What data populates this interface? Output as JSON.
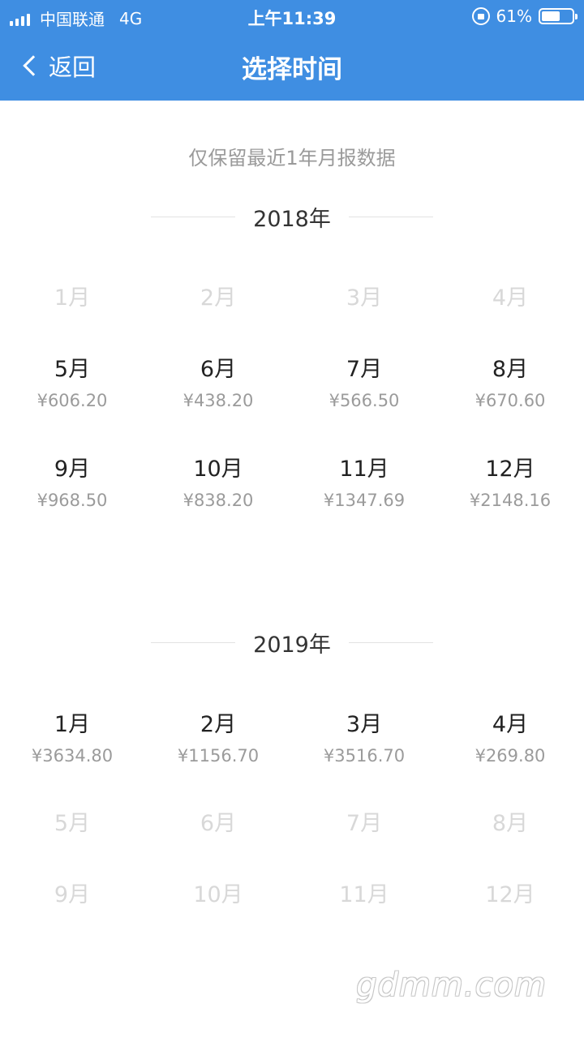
{
  "status_bar": {
    "carrier": "中国联通",
    "network": "4G",
    "time": "上午11:39",
    "battery_percent": "61%",
    "battery_level": 0.61
  },
  "nav": {
    "back_label": "返回",
    "title": "选择时间"
  },
  "note": "仅保留最近1年月报数据",
  "years": [
    {
      "label": "2018年",
      "months": [
        {
          "label": "1月",
          "amount": "",
          "enabled": false
        },
        {
          "label": "2月",
          "amount": "",
          "enabled": false
        },
        {
          "label": "3月",
          "amount": "",
          "enabled": false
        },
        {
          "label": "4月",
          "amount": "",
          "enabled": false
        },
        {
          "label": "5月",
          "amount": "¥606.20",
          "enabled": true
        },
        {
          "label": "6月",
          "amount": "¥438.20",
          "enabled": true
        },
        {
          "label": "7月",
          "amount": "¥566.50",
          "enabled": true
        },
        {
          "label": "8月",
          "amount": "¥670.60",
          "enabled": true
        },
        {
          "label": "9月",
          "amount": "¥968.50",
          "enabled": true
        },
        {
          "label": "10月",
          "amount": "¥838.20",
          "enabled": true
        },
        {
          "label": "11月",
          "amount": "¥1347.69",
          "enabled": true
        },
        {
          "label": "12月",
          "amount": "¥2148.16",
          "enabled": true
        }
      ]
    },
    {
      "label": "2019年",
      "months": [
        {
          "label": "1月",
          "amount": "¥3634.80",
          "enabled": true
        },
        {
          "label": "2月",
          "amount": "¥1156.70",
          "enabled": true
        },
        {
          "label": "3月",
          "amount": "¥3516.70",
          "enabled": true
        },
        {
          "label": "4月",
          "amount": "¥269.80",
          "enabled": true
        },
        {
          "label": "5月",
          "amount": "",
          "enabled": false
        },
        {
          "label": "6月",
          "amount": "",
          "enabled": false
        },
        {
          "label": "7月",
          "amount": "",
          "enabled": false
        },
        {
          "label": "8月",
          "amount": "",
          "enabled": false
        },
        {
          "label": "9月",
          "amount": "",
          "enabled": false
        },
        {
          "label": "10月",
          "amount": "",
          "enabled": false
        },
        {
          "label": "11月",
          "amount": "",
          "enabled": false
        },
        {
          "label": "12月",
          "amount": "",
          "enabled": false
        }
      ]
    }
  ],
  "watermark": "gdmm.com",
  "colors": {
    "header_bg": "#3f8ee2",
    "text_primary": "#222222",
    "text_secondary": "#9b9b9b",
    "text_disabled": "#d8d8d8"
  }
}
